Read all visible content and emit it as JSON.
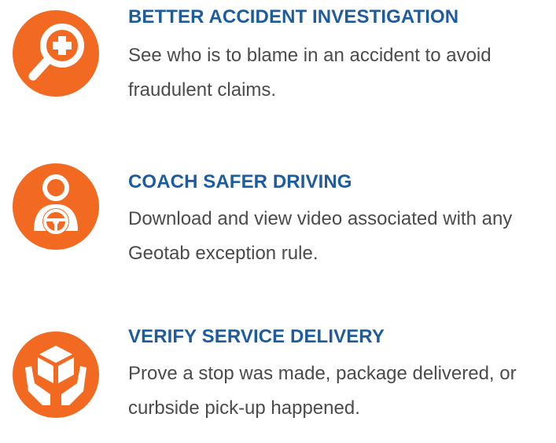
{
  "colors": {
    "accent": "#f26a22",
    "title": "#1f5c9e",
    "text": "#4b4b4d",
    "icon_fg": "#ffffff"
  },
  "features": [
    {
      "icon": "magnifier-plus-icon",
      "title": "BETTER ACCIDENT INVESTIGATION",
      "description": "See who is to blame in an accident to avoid fraudulent claims."
    },
    {
      "icon": "driver-steering-wheel-icon",
      "title": "COACH SAFER DRIVING",
      "description": "Download and view video associated with any Geotab exception rule."
    },
    {
      "icon": "hands-package-icon",
      "title": "VERIFY SERVICE DELIVERY",
      "description": "Prove a stop was made, package delivered, or curbside pick-up happened."
    }
  ]
}
